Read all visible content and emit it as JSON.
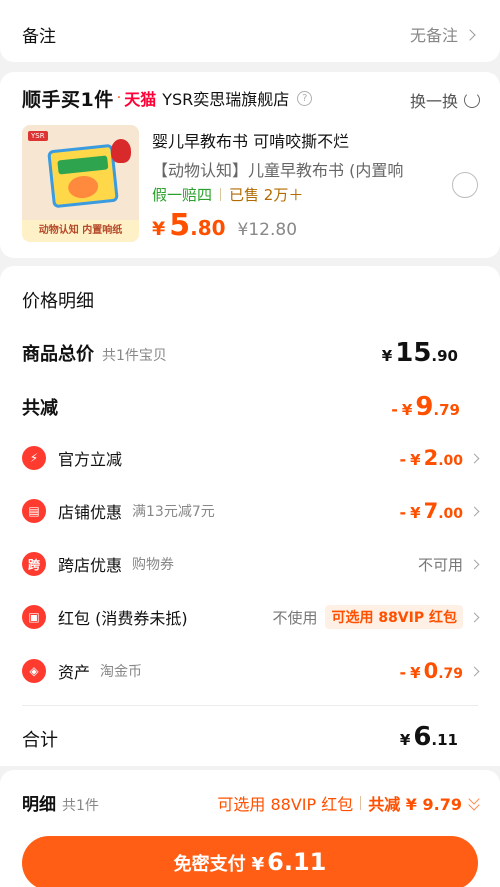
{
  "note": {
    "label": "备注",
    "value": "无备注"
  },
  "promo": {
    "brand": "顺手买1件",
    "platform": "天猫",
    "store": "YSR奕思瑞旗舰店",
    "swap_label": "换一换",
    "product": {
      "title": "婴儿早教布书 可啃咬撕不烂",
      "subtitle": "【动物认知】儿童早教布书 (内置响",
      "image_banner": "动物认知 内置响纸",
      "guarantee": "假一赔四",
      "sold": "已售 2万＋",
      "price_currency": "¥",
      "price_int": "5",
      "price_dec": ".80",
      "original_price": "¥12.80"
    }
  },
  "detail": {
    "title": "价格明细",
    "subtotal": {
      "label": "商品总价",
      "sub": "共1件宝贝",
      "currency": "¥",
      "int": "15",
      "dec": ".90"
    },
    "total_discount": {
      "label": "共减",
      "minus": "-",
      "currency": "¥",
      "int": "9",
      "dec": ".79"
    },
    "items": [
      {
        "icon": "lightning-icon",
        "label": "官方立减",
        "sub": "",
        "minus": "-",
        "currency": "¥",
        "int": "2",
        "dec": ".00"
      },
      {
        "icon": "shop-icon",
        "label": "店铺优惠",
        "sub": "满13元减7元",
        "minus": "-",
        "currency": "¥",
        "int": "7",
        "dec": ".00"
      },
      {
        "icon": "cross-store-icon",
        "label": "跨店优惠",
        "sub": "购物券",
        "status": "不可用"
      },
      {
        "icon": "red-packet-icon",
        "label": "红包 (消费券未抵)",
        "status": "不使用",
        "pill": "可选用 88VIP 红包"
      },
      {
        "icon": "asset-icon",
        "label": "资产",
        "sub": "淘金币",
        "minus": "-",
        "currency": "¥",
        "int": "0",
        "dec": ".79"
      }
    ],
    "total": {
      "label": "合计",
      "currency": "¥",
      "int": "6",
      "dec": ".11"
    }
  },
  "bottom": {
    "label": "明细",
    "sub": "共1件",
    "vip": "可选用 88VIP 红包",
    "save": "共减 ¥ 9.79",
    "pay_label": "免密支付",
    "pay_currency": "¥",
    "pay_amount": "6.11"
  },
  "colors": {
    "accent": "#ff5000",
    "button": "#ff5e14",
    "tmall": "#ff0036",
    "guarantee": "#2aa12a"
  }
}
